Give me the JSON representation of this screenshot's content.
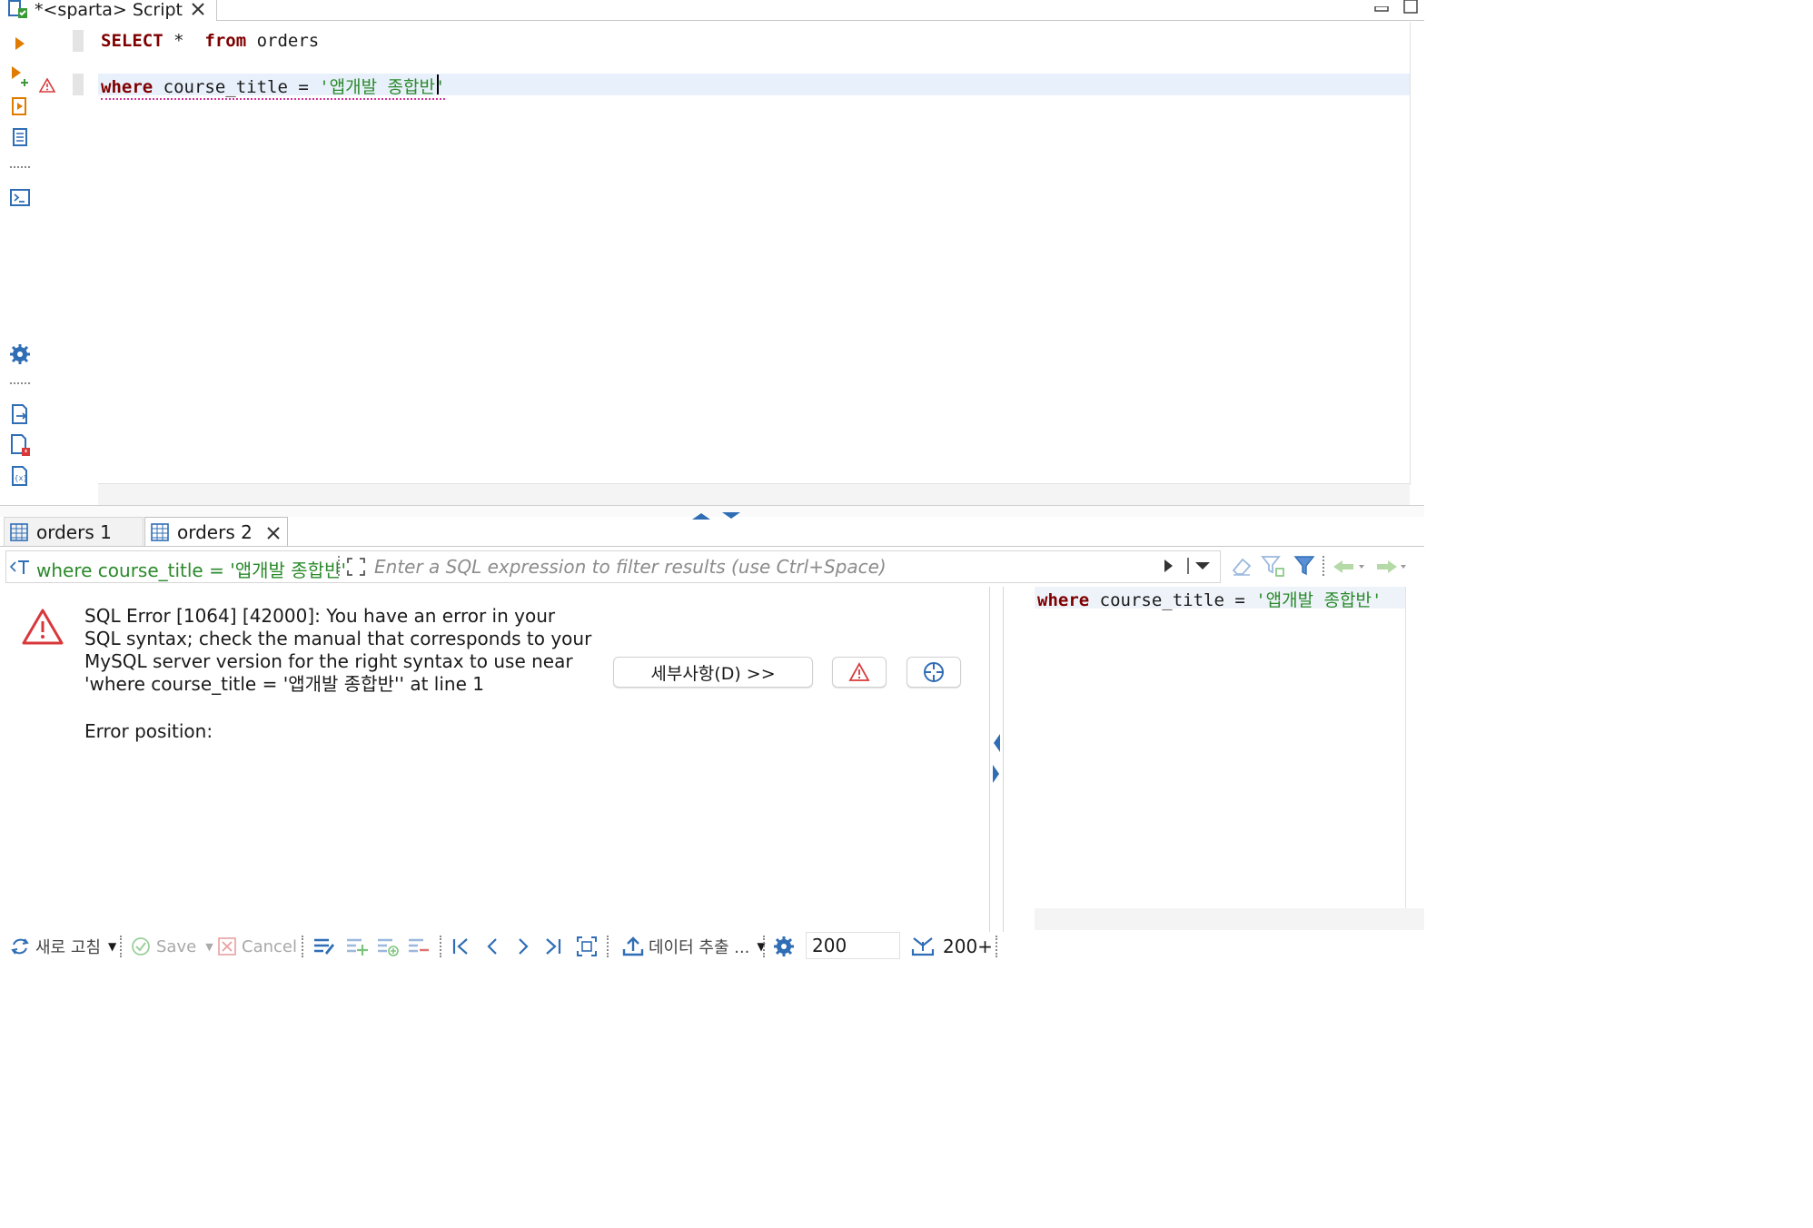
{
  "editor": {
    "tab_title": "*<sparta> Script",
    "line1": {
      "kw1": "SELECT",
      "op": " *  ",
      "kw2": "from",
      "rest": " orders"
    },
    "line2": {
      "kw1": "where",
      "rest": " course_title = ",
      "str": "'앱개발 종합반'"
    }
  },
  "results": {
    "tabs": [
      {
        "label": "orders 1"
      },
      {
        "label": "orders 2"
      }
    ],
    "filter": {
      "current": "where course_title = '앱개발 종합반'",
      "placeholder": "Enter a SQL expression to filter results (use Ctrl+Space)"
    },
    "error": {
      "message": "SQL Error [1064] [42000]: You have an error in your SQL syntax; check the manual that corresponds to your MySQL server version for the right syntax to use near 'where course_title = '앱개발 종합반'' at line 1",
      "position_label": "Error position:",
      "details_button": "세부사항(D) >>"
    },
    "side_query": {
      "kw": "where",
      "rest": " course_title = ",
      "str": "'앱개발 종합반'"
    }
  },
  "toolbar": {
    "refresh": "새로 고침",
    "save": "Save",
    "cancel": "Cancel",
    "export": "데이터 추출 ...",
    "fetch_size": "200",
    "fetch_count": "200+"
  },
  "colors": {
    "keyword": "#7f0000",
    "string": "#2a8a2a",
    "error_red": "#d9383a",
    "accent_blue": "#2f6db5",
    "run_orange": "#e07b00"
  }
}
